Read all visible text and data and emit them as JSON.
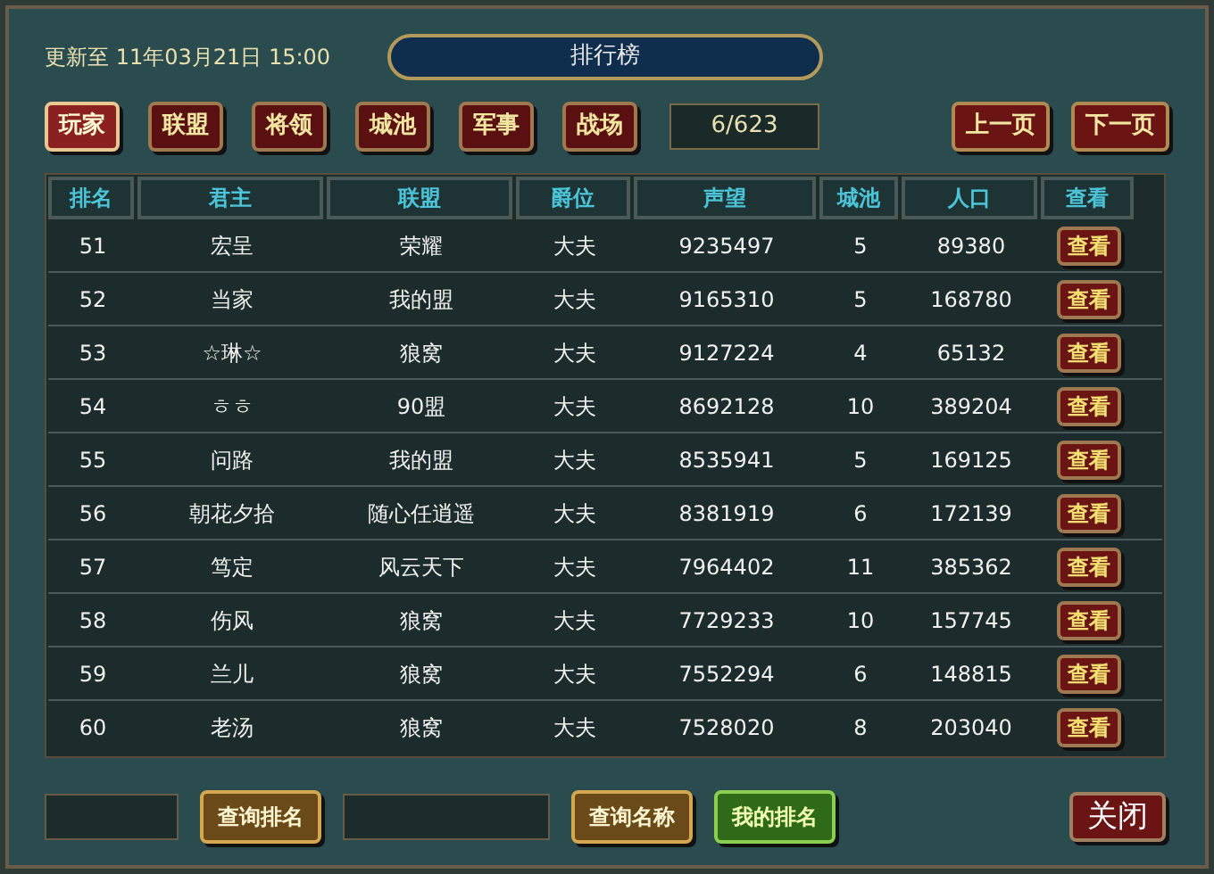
{
  "updated": "更新至 11年03月21日 15:00",
  "title": "排行榜",
  "tabs": [
    {
      "label": "玩家",
      "selected": true
    },
    {
      "label": "联盟",
      "selected": false
    },
    {
      "label": "将领",
      "selected": false
    },
    {
      "label": "城池",
      "selected": false
    },
    {
      "label": "军事",
      "selected": false
    },
    {
      "label": "战场",
      "selected": false
    }
  ],
  "page": "6/623",
  "pager": [
    "上一页",
    "下一页"
  ],
  "columns": [
    "排名",
    "君主",
    "联盟",
    "爵位",
    "声望",
    "城池",
    "人口",
    "查看"
  ],
  "rows": [
    [
      "51",
      "宏呈",
      "荣耀",
      "大夫",
      "9235497",
      "5",
      "89380",
      "查看"
    ],
    [
      "52",
      "当家",
      "我的盟",
      "大夫",
      "9165310",
      "5",
      "168780",
      "查看"
    ],
    [
      "53",
      "☆琳☆",
      "狼窝",
      "大夫",
      "9127224",
      "4",
      "65132",
      "查看"
    ],
    [
      "54",
      "ㅎㅎ",
      "90盟",
      "大夫",
      "8692128",
      "10",
      "389204",
      "查看"
    ],
    [
      "55",
      "问路",
      "我的盟",
      "大夫",
      "8535941",
      "5",
      "169125",
      "查看"
    ],
    [
      "56",
      "朝花夕拾",
      "随心任逍遥",
      "大夫",
      "8381919",
      "6",
      "172139",
      "查看"
    ],
    [
      "57",
      "笃定",
      "风云天下",
      "大夫",
      "7964402",
      "11",
      "385362",
      "查看"
    ],
    [
      "58",
      "伤风",
      "狼窝",
      "大夫",
      "7729233",
      "10",
      "157745",
      "查看"
    ],
    [
      "59",
      "兰儿",
      "狼窝",
      "大夫",
      "7552294",
      "6",
      "148815",
      "查看"
    ],
    [
      "60",
      "老汤",
      "狼窝",
      "大夫",
      "7528020",
      "8",
      "203040",
      "查看"
    ]
  ],
  "footer": [
    {
      "kind": "field"
    },
    {
      "kind": "gold",
      "label": "查询排名"
    },
    {
      "kind": "field"
    },
    {
      "kind": "gold",
      "label": "查询名称"
    },
    {
      "kind": "green",
      "label": "我的排名"
    }
  ],
  "close": "关闭"
}
